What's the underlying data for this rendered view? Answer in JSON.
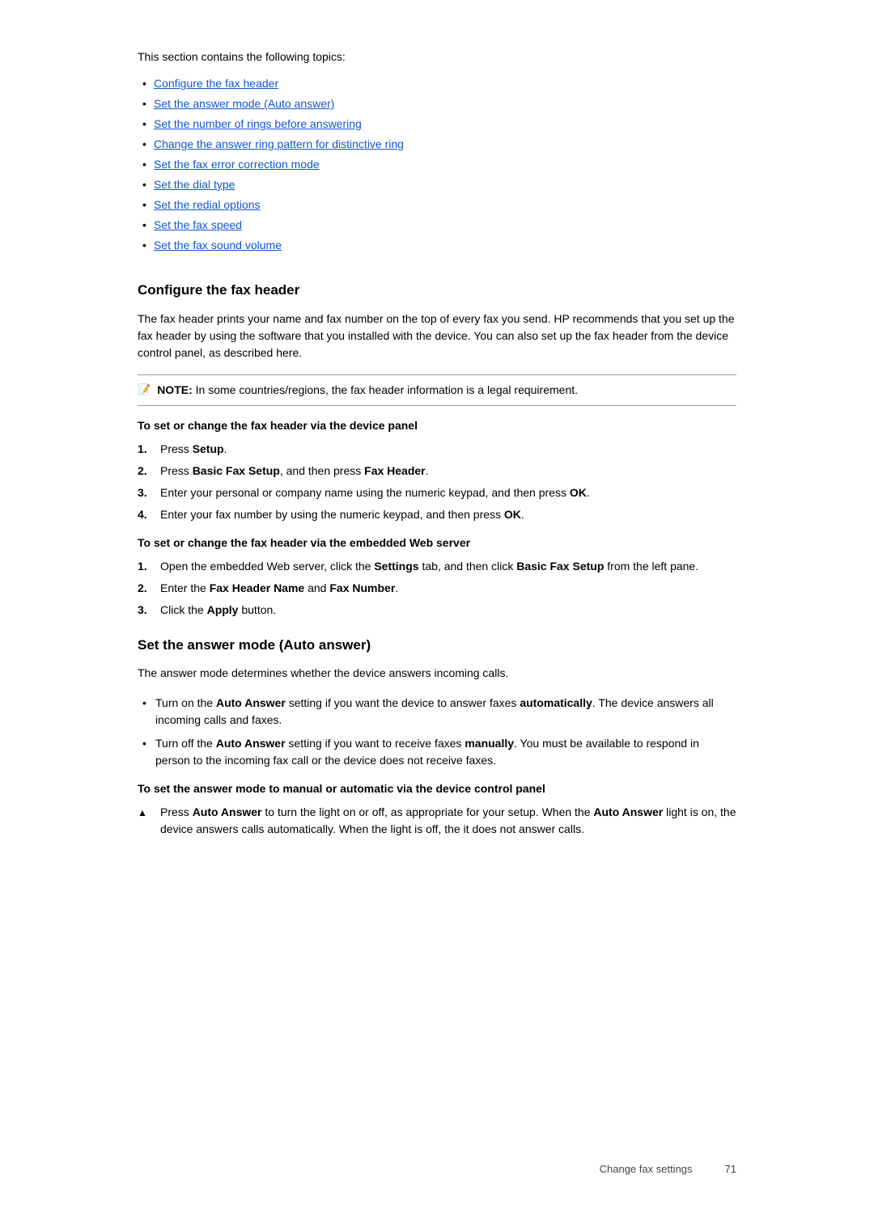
{
  "intro": {
    "text": "This section contains the following topics:"
  },
  "toc": {
    "items": [
      {
        "label": "Configure the fax header",
        "href": "#configure-fax-header"
      },
      {
        "label": "Set the answer mode (Auto answer)",
        "href": "#set-answer-mode"
      },
      {
        "label": "Set the number of rings before answering",
        "href": "#set-rings"
      },
      {
        "label": "Change the answer ring pattern for distinctive ring",
        "href": "#change-ring-pattern"
      },
      {
        "label": "Set the fax error correction mode",
        "href": "#set-error-correction"
      },
      {
        "label": "Set the dial type",
        "href": "#set-dial-type"
      },
      {
        "label": "Set the redial options",
        "href": "#set-redial"
      },
      {
        "label": "Set the fax speed",
        "href": "#set-fax-speed"
      },
      {
        "label": "Set the fax sound volume",
        "href": "#set-sound-volume"
      }
    ]
  },
  "section1": {
    "heading": "Configure the fax header",
    "body": "The fax header prints your name and fax number on the top of every fax you send. HP recommends that you set up the fax header by using the software that you installed with the device. You can also set up the fax header from the device control panel, as described here.",
    "note": {
      "label": "NOTE:",
      "text": "In some countries/regions, the fax header information is a legal requirement."
    },
    "subheading1": "To set or change the fax header via the device panel",
    "steps1": [
      {
        "num": "1.",
        "text": "Press <b>Setup</b>."
      },
      {
        "num": "2.",
        "text": "Press <b>Basic Fax Setup</b>, and then press <b>Fax Header</b>."
      },
      {
        "num": "3.",
        "text": "Enter your personal or company name using the numeric keypad, and then press <b>OK</b>."
      },
      {
        "num": "4.",
        "text": "Enter your fax number by using the numeric keypad, and then press <b>OK</b>."
      }
    ],
    "subheading2": "To set or change the fax header via the embedded Web server",
    "steps2": [
      {
        "num": "1.",
        "text": "Open the embedded Web server, click the <b>Settings</b> tab, and then click <b>Basic Fax Setup</b> from the left pane."
      },
      {
        "num": "2.",
        "text": "Enter the <b>Fax Header Name</b> and <b>Fax Number</b>."
      },
      {
        "num": "3.",
        "text": "Click the <b>Apply</b> button."
      }
    ]
  },
  "section2": {
    "heading": "Set the answer mode (Auto answer)",
    "body": "The answer mode determines whether the device answers incoming calls.",
    "bullets": [
      {
        "text": "Turn on the <b>Auto Answer</b> setting if you want the device to answer faxes <b>automatically</b>. The device answers all incoming calls and faxes."
      },
      {
        "text": "Turn off the <b>Auto Answer</b> setting if you want to receive faxes <b>manually</b>. You must be available to respond in person to the incoming fax call or the device does not receive faxes."
      }
    ],
    "subheading": "To set the answer mode to manual or automatic via the device control panel",
    "warning_items": [
      {
        "text": "Press <b>Auto Answer</b> to turn the light on or off, as appropriate for your setup. When the <b>Auto Answer</b> light is on, the device answers calls automatically. When the light is off, the it does not answer calls."
      }
    ]
  },
  "footer": {
    "label": "Change fax settings",
    "page_number": "71"
  }
}
